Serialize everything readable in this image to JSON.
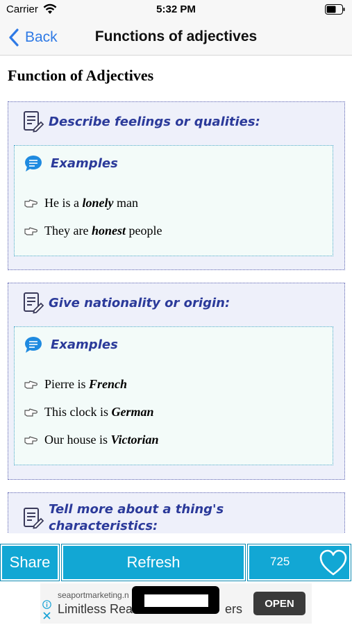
{
  "status_bar": {
    "carrier": "Carrier",
    "time": "5:32 PM"
  },
  "nav": {
    "back_label": "Back",
    "title": "Functions of adjectives"
  },
  "page_title": "Function of Adjectives",
  "sections": [
    {
      "title": "Describe feelings or qualities:",
      "examples_label": "Examples",
      "examples": [
        {
          "before": "He is a ",
          "emph": "lonely",
          "after": " man"
        },
        {
          "before": "They are ",
          "emph": "honest",
          "after": " people"
        }
      ]
    },
    {
      "title": "Give nationality or origin:",
      "examples_label": "Examples",
      "examples": [
        {
          "before": "Pierre is ",
          "emph": "French",
          "after": ""
        },
        {
          "before": "This clock is ",
          "emph": "German",
          "after": ""
        },
        {
          "before": "Our house is ",
          "emph": "Victorian",
          "after": ""
        }
      ]
    },
    {
      "title": "Tell more about a thing's characteristics:"
    }
  ],
  "toolbar": {
    "share_label": "Share",
    "refresh_label": "Refresh",
    "like_count": "725"
  },
  "ad": {
    "domain": "seaportmarketing.n",
    "headline": "Limitless Rea",
    "headline_tail": "ers",
    "open_label": "OPEN"
  },
  "colors": {
    "accent_blue": "#2f7ae5",
    "toolbar_blue": "#12a7d4",
    "heading_indigo": "#2b3a9a"
  },
  "icons": [
    "wifi-icon",
    "battery-icon",
    "back-chevron-icon",
    "note-edit-icon",
    "chat-bubble-icon",
    "pointing-hand-icon",
    "heart-icon",
    "info-icon",
    "close-icon"
  ]
}
